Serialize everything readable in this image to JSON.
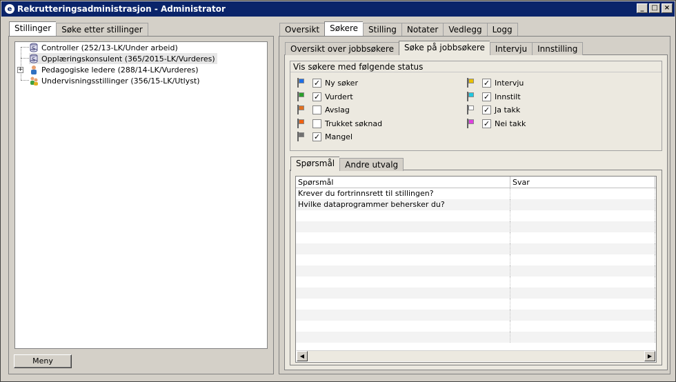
{
  "window": {
    "title": "Rekrutteringsadministrasjon - Administrator",
    "minimize": "_",
    "maximize": "□",
    "close": "×"
  },
  "left_tabs": [
    "Stillinger",
    "Søke etter stillinger"
  ],
  "tree": [
    {
      "label": "Controller (252/13-LK/Under arbeid)",
      "icon": "stack-icon"
    },
    {
      "label": "Opplæringskonsulent (365/2015-LK/Vurderes)",
      "icon": "stack-icon"
    },
    {
      "label": "Pedagogiske ledere (288/14-LK/Vurderes)",
      "icon": "person-icon",
      "expander": "+"
    },
    {
      "label": "Undervisningsstillinger (356/15-LK/Utlyst)",
      "icon": "group-icon"
    }
  ],
  "menu_button": "Meny",
  "main_tabs": [
    "Oversikt",
    "Søkere",
    "Stilling",
    "Notater",
    "Vedlegg",
    "Logg"
  ],
  "sub_tabs": [
    "Oversikt over jobbsøkere",
    "Søke på jobbsøkere",
    "Intervju",
    "Innstilling"
  ],
  "status_group": {
    "title": "Vis søkere med følgende status",
    "left": [
      {
        "label": "Ny søker",
        "checked": true,
        "color": "#1e6ee6"
      },
      {
        "label": "Vurdert",
        "checked": true,
        "color": "#2aa02a"
      },
      {
        "label": "Avslag",
        "checked": false,
        "color": "#e07020"
      },
      {
        "label": "Trukket søknad",
        "checked": false,
        "color": "#f06010"
      },
      {
        "label": "Mangel",
        "checked": true,
        "color": "#707070"
      }
    ],
    "right": [
      {
        "label": "Intervju",
        "checked": true,
        "color": "#e8c000"
      },
      {
        "label": "Innstilt",
        "checked": true,
        "color": "#20c8e0"
      },
      {
        "label": "Ja takk",
        "checked": true,
        "color": "#ffffff"
      },
      {
        "label": "Nei takk",
        "checked": true,
        "color": "#e040e0"
      }
    ]
  },
  "question_tabs": [
    "Spørsmål",
    "Andre utvalg"
  ],
  "grid": {
    "columns": [
      "Spørsmål",
      "Svar"
    ],
    "rows": [
      [
        "Krever du fortrinnsrett til stillingen?",
        ""
      ],
      [
        "Hvilke dataprogrammer behersker du?",
        ""
      ]
    ],
    "empty_rows": 12
  },
  "checkmark": "✓"
}
